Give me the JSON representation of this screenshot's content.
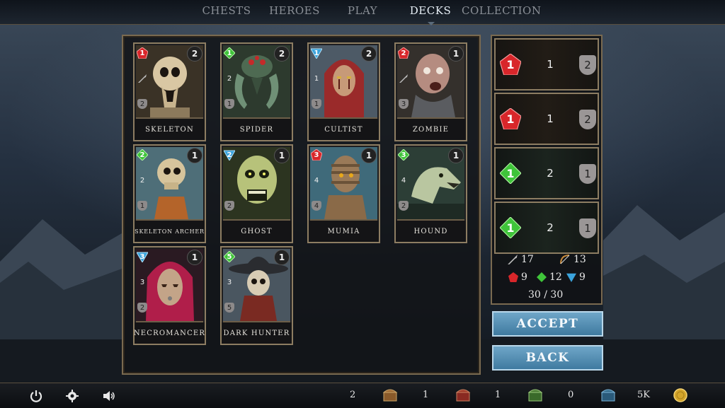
{
  "nav": {
    "tabs": [
      {
        "label": "CHESTS",
        "active": false
      },
      {
        "label": "HEROES",
        "active": false
      },
      {
        "label": "PLAY",
        "active": false
      },
      {
        "label": "DECKS",
        "active": true
      },
      {
        "label": "COLLECTION",
        "active": false
      }
    ]
  },
  "collection": {
    "cards": [
      {
        "name": "SKELETON",
        "count": "2",
        "cost": "1",
        "cost_color": "red",
        "atk": "",
        "def": "2"
      },
      {
        "name": "SPIDER",
        "count": "2",
        "cost": "1",
        "cost_color": "green",
        "atk": "2",
        "def": "1"
      },
      {
        "name": "CULTIST",
        "count": "2",
        "cost": "1",
        "cost_color": "blue",
        "atk": "1",
        "def": "1"
      },
      {
        "name": "ZOMBIE",
        "count": "1",
        "cost": "2",
        "cost_color": "red",
        "atk": "",
        "def": "3"
      },
      {
        "name": "SKELETON ARCHER",
        "count": "1",
        "cost": "2",
        "cost_color": "green",
        "atk": "2",
        "def": "1"
      },
      {
        "name": "GHOST",
        "count": "1",
        "cost": "2",
        "cost_color": "blue",
        "atk": "",
        "def": "2"
      },
      {
        "name": "MUMIA",
        "count": "1",
        "cost": "3",
        "cost_color": "red",
        "atk": "4",
        "def": "4"
      },
      {
        "name": "HOUND",
        "count": "1",
        "cost": "3",
        "cost_color": "green",
        "atk": "4",
        "def": "2"
      },
      {
        "name": "NECROMANCER",
        "count": "1",
        "cost": "3",
        "cost_color": "blue",
        "atk": "3",
        "def": "2"
      },
      {
        "name": "DARK HUNTER",
        "count": "1",
        "cost": "5",
        "cost_color": "green",
        "atk": "3",
        "def": "5"
      }
    ]
  },
  "deck": {
    "slots": [
      {
        "cost": "1",
        "cost_color": "red",
        "atk": "1",
        "def": "2"
      },
      {
        "cost": "1",
        "cost_color": "red",
        "atk": "1",
        "def": "2"
      },
      {
        "cost": "1",
        "cost_color": "green",
        "atk": "2",
        "def": "1"
      },
      {
        "cost": "1",
        "cost_color": "green",
        "atk": "2",
        "def": "1"
      }
    ],
    "stats": {
      "sword_count": "17",
      "bow_count": "13",
      "red_gems": "9",
      "green_gems": "12",
      "blue_gems": "9",
      "total": "30 / 30"
    }
  },
  "buttons": {
    "accept": "ACCEPT",
    "back": "BACK"
  },
  "bottom": {
    "resources": [
      {
        "count": "2",
        "icon": "wooden-chest-icon"
      },
      {
        "count": "1",
        "icon": "red-chest-icon"
      },
      {
        "count": "1",
        "icon": "green-chest-icon"
      },
      {
        "count": "0",
        "icon": "blue-chest-icon"
      },
      {
        "count": "5K",
        "icon": "gold-coin-icon"
      }
    ]
  },
  "colors": {
    "gem_red": "#d8262a",
    "gem_green": "#3fc43a",
    "gem_blue": "#3aa3dc",
    "button_blue": "#4f8db4",
    "frame_gold": "#8d7d62"
  }
}
